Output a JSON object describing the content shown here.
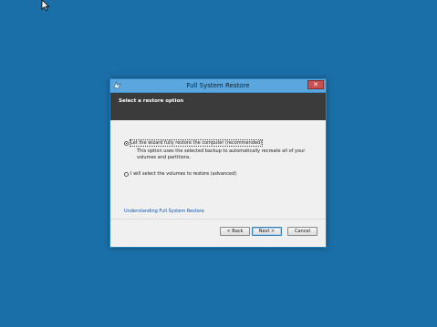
{
  "window": {
    "title": "Full System Restore",
    "close_glyph": "✕"
  },
  "header": {
    "title": "Select a restore option"
  },
  "options": [
    {
      "label": "Let the wizard fully restore the computer (recommended)",
      "description": "This option uses the selected backup to automatically recreate all of your volumes and partitions.",
      "checked": true
    },
    {
      "label": "I will select the volumes to restore (advanced)",
      "checked": false
    }
  ],
  "link": {
    "text": "Understanding Full System Restore"
  },
  "buttons": {
    "back": "< Back",
    "next": "Next >",
    "cancel": "Cancel"
  },
  "colors": {
    "desktop": "#1a6fa8",
    "titlebar": "#5aa6dd",
    "header_band": "#3b3b3b",
    "link": "#0b55b5"
  }
}
